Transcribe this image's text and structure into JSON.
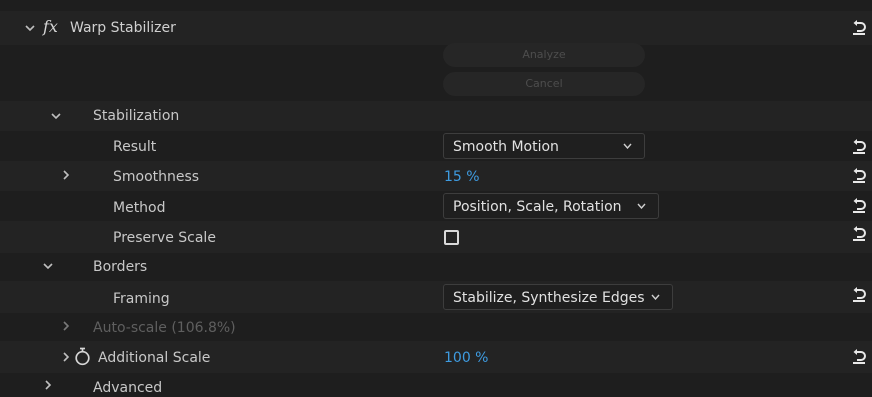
{
  "effect": {
    "fx_symbol": "fx",
    "name": "Warp Stabilizer"
  },
  "buttons": {
    "analyze": "Analyze",
    "cancel": "Cancel"
  },
  "stabilization": {
    "label": "Stabilization",
    "result": {
      "label": "Result",
      "value": "Smooth Motion"
    },
    "smoothness": {
      "label": "Smoothness",
      "value": "15 %"
    },
    "method": {
      "label": "Method",
      "value": "Position, Scale, Rotation"
    },
    "preserve_scale": {
      "label": "Preserve Scale",
      "checked": false
    }
  },
  "borders": {
    "label": "Borders",
    "framing": {
      "label": "Framing",
      "value": "Stabilize, Synthesize Edges"
    },
    "auto_scale": {
      "label": "Auto-scale (106.8%)"
    },
    "additional_scale": {
      "label": "Additional Scale",
      "value": "100 %"
    }
  },
  "advanced": {
    "label": "Advanced"
  },
  "colors": {
    "background": "#1e1e1e",
    "stripe": "#232323",
    "text": "#c8c8c8",
    "value_blue": "#3e9be0",
    "disabled": "#5f5f5f"
  },
  "icons": [
    "chevron-down-icon",
    "chevron-right-icon",
    "fx-icon",
    "reset-icon",
    "stopwatch-icon",
    "caret-down-icon"
  ]
}
